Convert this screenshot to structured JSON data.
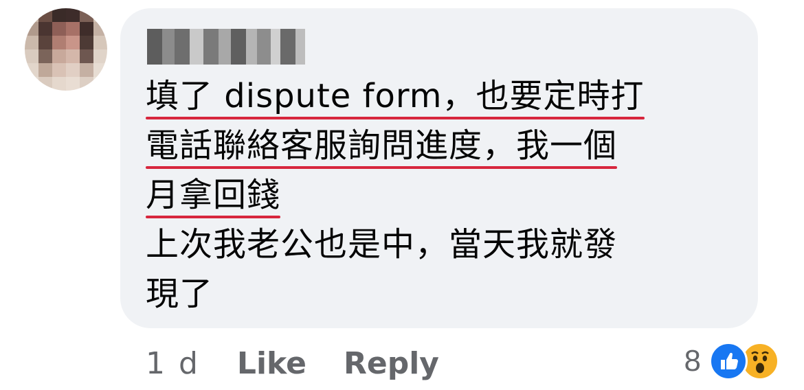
{
  "comment": {
    "lines": [
      "填了 dispute form，也要定時打",
      "電話聯絡客服詢問進度，我一個",
      "月拿回錢",
      "上次我老公也是中，當天我就發",
      "現了"
    ]
  },
  "actions": {
    "time": "1 d",
    "like_label": "Like",
    "reply_label": "Reply"
  },
  "reactions": {
    "count": "8",
    "icons": [
      "like-icon",
      "wow-icon"
    ]
  },
  "colors": {
    "bubble": "#f0f2f5",
    "text": "#050505",
    "secondary": "#65676b",
    "underline": "#d7263d",
    "like": "#1877f2",
    "wow": "#f7b125"
  }
}
